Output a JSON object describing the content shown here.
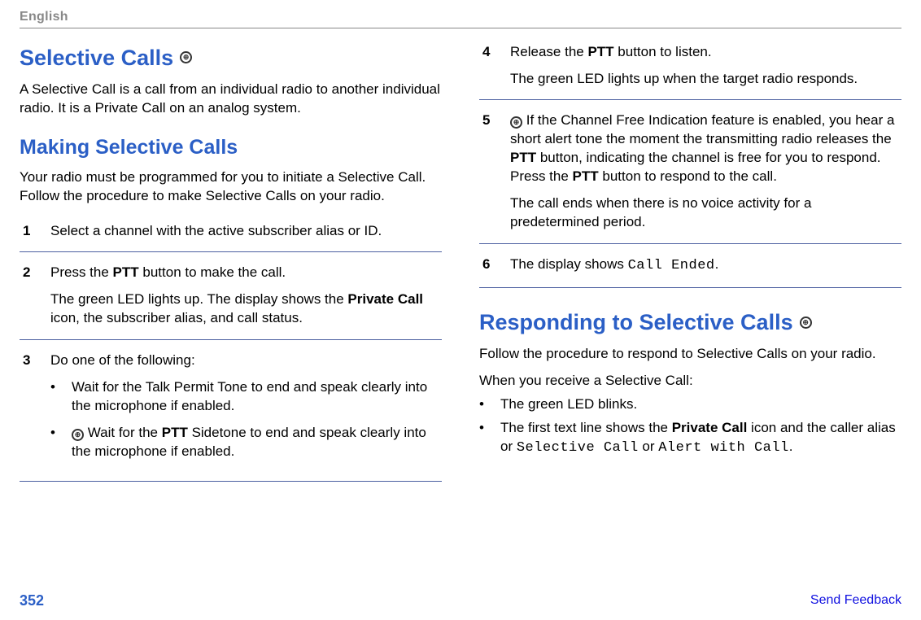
{
  "lang_label": "English",
  "page_number": "352",
  "feedback_label": "Send Feedback",
  "left": {
    "h1": "Selective Calls",
    "icon_name": "radio-icon",
    "intro": "A Selective Call is a call from an individual radio to another individual radio. It is a Private Call on an analog system.",
    "h2": "Making Selective Calls",
    "intro2": "Your radio must be programmed for you to initiate a Selective Call. Follow the procedure to make Selective Calls on your radio.",
    "steps": [
      {
        "num": "1",
        "p1": "Select a channel with the active subscriber alias or ID."
      },
      {
        "num": "2",
        "p1_pre": "Press the ",
        "p1_bold": "PTT",
        "p1_post": " button to make the call.",
        "p2_pre": "The green LED lights up. The display shows the ",
        "p2_bold": "Private Call",
        "p2_post": " icon, the subscriber alias, and call status."
      },
      {
        "num": "3",
        "p1": "Do one of the following:",
        "b1": "Wait for the Talk Permit Tone to end and speak clearly into the microphone if enabled.",
        "b2_pre": " Wait for the ",
        "b2_bold": "PTT",
        "b2_post": " Sidetone to end and speak clearly into the microphone if enabled."
      }
    ]
  },
  "right": {
    "steps": [
      {
        "num": "4",
        "p1_pre": "Release the ",
        "p1_bold": "PTT",
        "p1_post": " button to listen.",
        "p2": "The green LED lights up when the target radio responds."
      },
      {
        "num": "5",
        "p1_pre": " If the Channel Free Indication feature is enabled, you hear a short alert tone the moment the transmitting radio releases the ",
        "p1_bold": "PTT",
        "p1_mid": " button, indicating the channel is free for you to respond. Press the ",
        "p1_bold2": "PTT",
        "p1_post": " button to respond to the call.",
        "p2": "The call ends when there is no voice activity for a predetermined period."
      },
      {
        "num": "6",
        "p1_pre": "The display shows ",
        "p1_mono": "Call Ended",
        "p1_post": "."
      }
    ],
    "h1": "Responding to Selective Calls",
    "icon_name": "radio-icon",
    "intro": "Follow the procedure to respond to Selective Calls on your radio.",
    "intro2": "When you receive a Selective Call:",
    "bullets": {
      "b1": "The green LED blinks.",
      "b2_pre": "The first text line shows the ",
      "b2_bold": "Private Call",
      "b2_mid": " icon and the caller alias or ",
      "b2_mono1": "Selective Call",
      "b2_or": " or ",
      "b2_mono2": "Alert with Call",
      "b2_post": "."
    }
  }
}
